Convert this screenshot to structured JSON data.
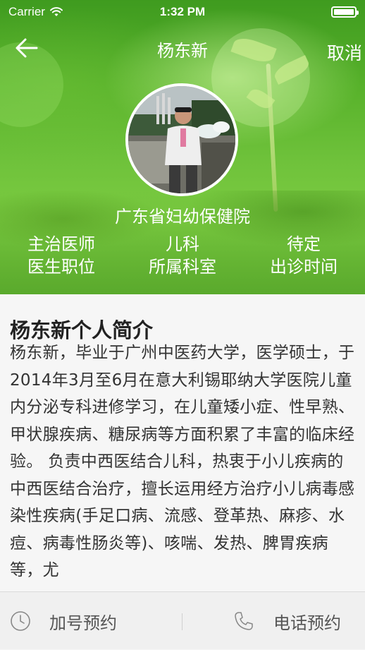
{
  "status_bar": {
    "carrier": "Carrier",
    "time": "1:32 PM"
  },
  "nav": {
    "title": "杨东新",
    "cancel_label": "取消",
    "back_icon": "arrow-left-icon"
  },
  "profile": {
    "hospital": "广东省妇幼保健院",
    "stats": [
      {
        "value": "主治医师",
        "label": "医生职位"
      },
      {
        "value": "儿科",
        "label": "所属科室"
      },
      {
        "value": "待定",
        "label": "出诊时间"
      }
    ]
  },
  "intro": {
    "title": "杨东新个人简介",
    "body": "杨东新，毕业于广州中医药大学，医学硕士，于2014年3月至6月在意大利锡耶纳大学医院儿童内分泌专科进修学习，在儿童矮小症、性早熟、甲状腺疾病、糖尿病等方面积累了丰富的临床经验。 负责中西医结合儿科，热衷于小儿疾病的中西医结合治疗，擅长运用经方治疗小儿病毒感染性疾病(手足口病、流感、登革热、麻疹、水痘、病毒性肠炎等)、咳喘、发热、脾胃疾病等，尤"
  },
  "bottom_bar": {
    "left_label": "加号预约",
    "left_icon": "clock-icon",
    "right_label": "电话预约",
    "right_icon": "phone-icon"
  }
}
